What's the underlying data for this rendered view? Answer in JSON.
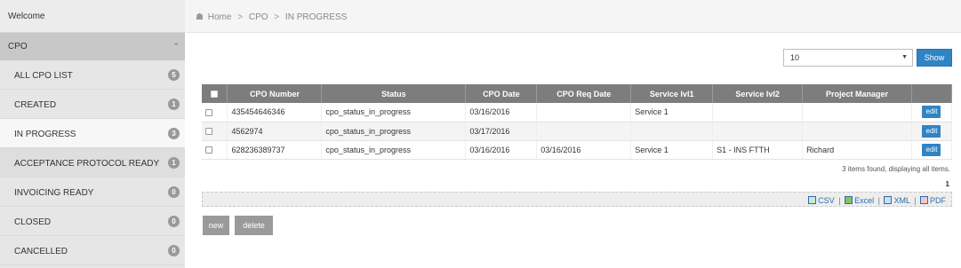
{
  "sidebar": {
    "welcome": "Welcome",
    "section": "CPO",
    "items": [
      {
        "label": "ALL CPO LIST",
        "count": "5"
      },
      {
        "label": "CREATED",
        "count": "1"
      },
      {
        "label": "IN PROGRESS",
        "count": "3"
      },
      {
        "label": "ACCEPTANCE PROTOCOL READY",
        "count": "1"
      },
      {
        "label": "INVOICING READY",
        "count": "0"
      },
      {
        "label": "CLOSED",
        "count": "0"
      },
      {
        "label": "CANCELLED",
        "count": "0"
      }
    ],
    "active_item": "IN PROGRESS"
  },
  "breadcrumb": {
    "home": "Home",
    "level1": "CPO",
    "level2": "IN PROGRESS",
    "separator": ">"
  },
  "page_size": {
    "value": "10",
    "button": "Show"
  },
  "table": {
    "headers": [
      "CPO Number",
      "Status",
      "CPO Date",
      "CPO Req Date",
      "Service lvl1",
      "Service lvl2",
      "Project Manager"
    ],
    "rows": [
      {
        "cpo_number": "435454646346",
        "status": "cpo_status_in_progress",
        "cpo_date": "03/16/2016",
        "req_date": "",
        "service1": "Service 1",
        "service2": "",
        "pm": "",
        "action": "edit"
      },
      {
        "cpo_number": "4562974",
        "status": "cpo_status_in_progress",
        "cpo_date": "03/17/2016",
        "req_date": "",
        "service1": "",
        "service2": "",
        "pm": "",
        "action": "edit"
      },
      {
        "cpo_number": "628236389737",
        "status": "cpo_status_in_progress",
        "cpo_date": "03/16/2016",
        "req_date": "03/16/2016",
        "service1": "Service 1",
        "service2": "S1 - INS FTTH",
        "pm": "Richard",
        "action": "edit"
      }
    ]
  },
  "footer": {
    "found_text": "3 items found, displaying all items.",
    "page": "1",
    "exports": [
      "CSV",
      "Excel",
      "XML",
      "PDF"
    ]
  },
  "actions": {
    "new": "new",
    "delete": "delete"
  },
  "colors": {
    "accent": "#2f84c4",
    "header_bg": "#7d7d7d",
    "sidebar_bg": "#e6e6e6"
  }
}
